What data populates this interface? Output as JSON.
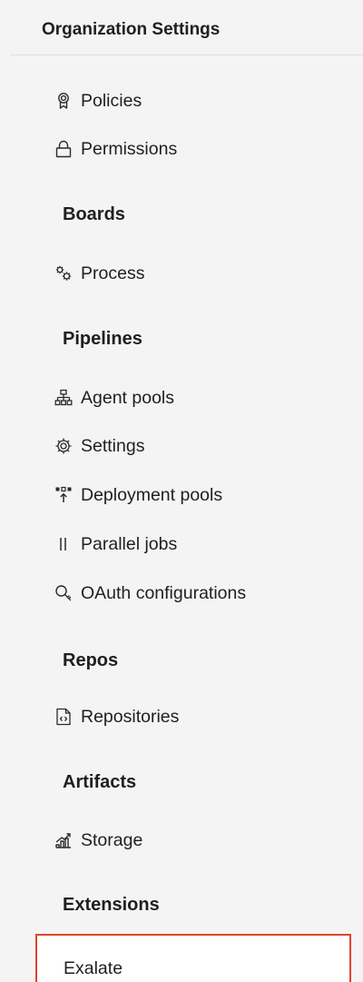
{
  "sidebar": {
    "title": "Organization Settings",
    "top_items": [
      {
        "label": "Policies",
        "icon": "ribbon-badge-icon"
      },
      {
        "label": "Permissions",
        "icon": "lock-icon"
      }
    ],
    "sections": [
      {
        "header": "Boards",
        "items": [
          {
            "label": "Process",
            "icon": "gears-icon"
          }
        ]
      },
      {
        "header": "Pipelines",
        "items": [
          {
            "label": "Agent pools",
            "icon": "hierarchy-icon"
          },
          {
            "label": "Settings",
            "icon": "gear-icon"
          },
          {
            "label": "Deployment pools",
            "icon": "deploy-icon"
          },
          {
            "label": "Parallel jobs",
            "icon": "parallel-bars-icon"
          },
          {
            "label": "OAuth configurations",
            "icon": "key-search-icon"
          }
        ]
      },
      {
        "header": "Repos",
        "items": [
          {
            "label": "Repositories",
            "icon": "code-file-icon"
          }
        ]
      },
      {
        "header": "Artifacts",
        "items": [
          {
            "label": "Storage",
            "icon": "storage-chart-icon"
          }
        ]
      },
      {
        "header": "Extensions",
        "items": [
          {
            "label": "Exalate",
            "selected": true
          }
        ]
      }
    ],
    "colors": {
      "background": "#f4f4f4",
      "text": "#1f1f1f",
      "divider": "#dcdcdc",
      "selection_border": "#e0432f"
    }
  }
}
